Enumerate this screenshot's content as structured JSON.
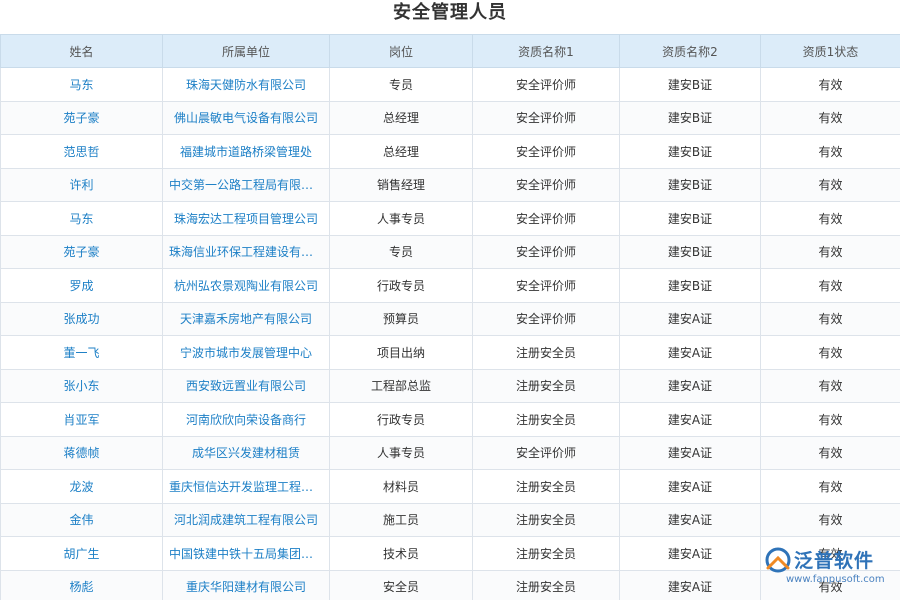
{
  "page": {
    "title": "安全管理人员"
  },
  "columns": [
    "姓名",
    "所属单位",
    "岗位",
    "资质名称1",
    "资质名称2",
    "资质1状态"
  ],
  "rows": [
    {
      "name": "马东",
      "unit": "珠海天健防水有限公司",
      "post": "专员",
      "cert1": "安全评价师",
      "cert2": "建安B证",
      "status": "有效"
    },
    {
      "name": "苑子豪",
      "unit": "佛山晨敏电气设备有限公司",
      "post": "总经理",
      "cert1": "安全评价师",
      "cert2": "建安B证",
      "status": "有效"
    },
    {
      "name": "范思哲",
      "unit": "福建城市道路桥梁管理处",
      "post": "总经理",
      "cert1": "安全评价师",
      "cert2": "建安B证",
      "status": "有效"
    },
    {
      "name": "许利",
      "unit": "中交第一公路工程局有限公司",
      "post": "销售经理",
      "cert1": "安全评价师",
      "cert2": "建安B证",
      "status": "有效"
    },
    {
      "name": "马东",
      "unit": "珠海宏达工程项目管理公司",
      "post": "人事专员",
      "cert1": "安全评价师",
      "cert2": "建安B证",
      "status": "有效"
    },
    {
      "name": "苑子豪",
      "unit": "珠海信业环保工程建设有限公司",
      "post": "专员",
      "cert1": "安全评价师",
      "cert2": "建安B证",
      "status": "有效"
    },
    {
      "name": "罗成",
      "unit": "杭州弘农景观陶业有限公司",
      "post": "行政专员",
      "cert1": "安全评价师",
      "cert2": "建安B证",
      "status": "有效"
    },
    {
      "name": "张成功",
      "unit": "天津嘉禾房地产有限公司",
      "post": "预算员",
      "cert1": "安全评价师",
      "cert2": "建安A证",
      "status": "有效"
    },
    {
      "name": "董一飞",
      "unit": "宁波市城市发展管理中心",
      "post": "项目出纳",
      "cert1": "注册安全员",
      "cert2": "建安A证",
      "status": "有效"
    },
    {
      "name": "张小东",
      "unit": "西安致远置业有限公司",
      "post": "工程部总监",
      "cert1": "注册安全员",
      "cert2": "建安A证",
      "status": "有效"
    },
    {
      "name": "肖亚军",
      "unit": "河南欣欣向荣设备商行",
      "post": "行政专员",
      "cert1": "注册安全员",
      "cert2": "建安A证",
      "status": "有效"
    },
    {
      "name": "蒋德帧",
      "unit": "成华区兴发建材租赁",
      "post": "人事专员",
      "cert1": "安全评价师",
      "cert2": "建安A证",
      "status": "有效"
    },
    {
      "name": "龙波",
      "unit": "重庆恒信达开发监理工程有限公司",
      "post": "材料员",
      "cert1": "注册安全员",
      "cert2": "建安A证",
      "status": "有效"
    },
    {
      "name": "金伟",
      "unit": "河北润成建筑工程有限公司",
      "post": "施工员",
      "cert1": "注册安全员",
      "cert2": "建安A证",
      "status": "有效"
    },
    {
      "name": "胡广生",
      "unit": "中国铁建中铁十五局集团有限公司",
      "post": "技术员",
      "cert1": "注册安全员",
      "cert2": "建安A证",
      "status": "有效"
    },
    {
      "name": "杨彪",
      "unit": "重庆华阳建材有限公司",
      "post": "安全员",
      "cert1": "注册安全员",
      "cert2": "建安A证",
      "status": "有效"
    }
  ],
  "watermark": {
    "name": "泛普软件",
    "url": "www.fanpusoft.com",
    "colors": {
      "blue": "#2f73b8",
      "orange": "#f08a24"
    },
    "icon": "fanpu-logo-icon"
  },
  "colors": {
    "header_bg": "#dcecf9",
    "link": "#1c7fc6",
    "border": "#dde3ea"
  }
}
